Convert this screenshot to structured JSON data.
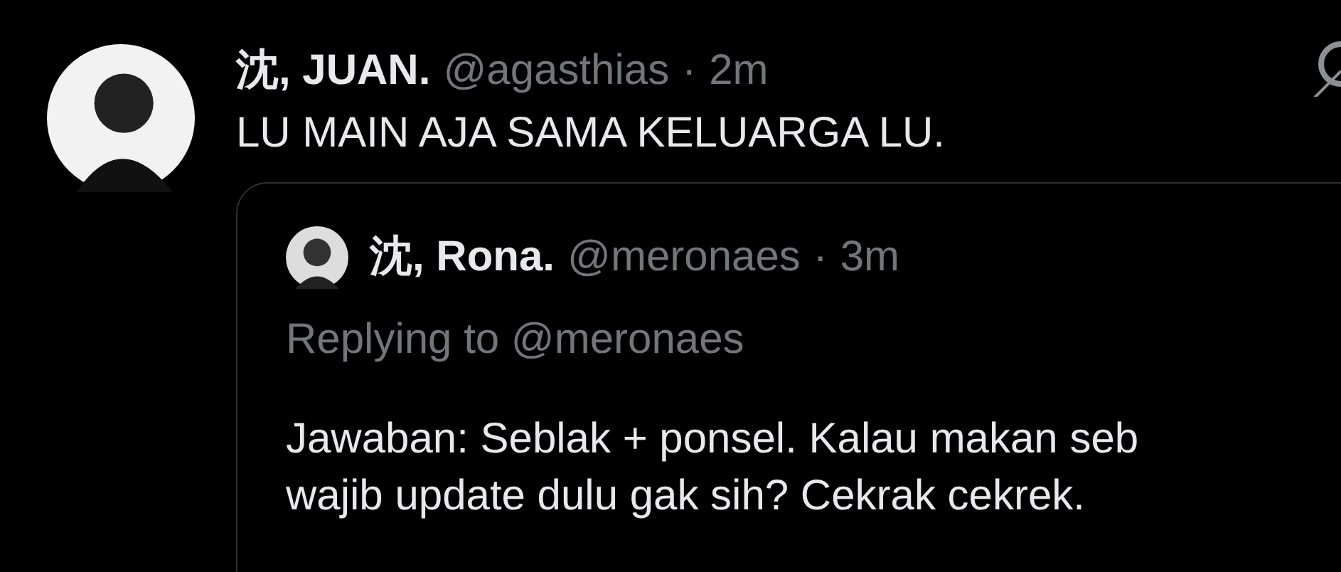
{
  "post": {
    "name": "沈, JUAN.",
    "handle": "@agasthias",
    "separator": "·",
    "time": "2m",
    "text": "LU MAIN AJA SAMA KELUARGA LU."
  },
  "quote": {
    "name": "沈, Rona.",
    "handle": "@meronaes",
    "separator": "·",
    "time": "3m",
    "replying": "Replying to @meronaes",
    "lines": [
      "Jawaban: Seblak + ponsel. Kalau makan seb",
      "wajib update dulu gak sih? Cekrak cekrek."
    ]
  }
}
